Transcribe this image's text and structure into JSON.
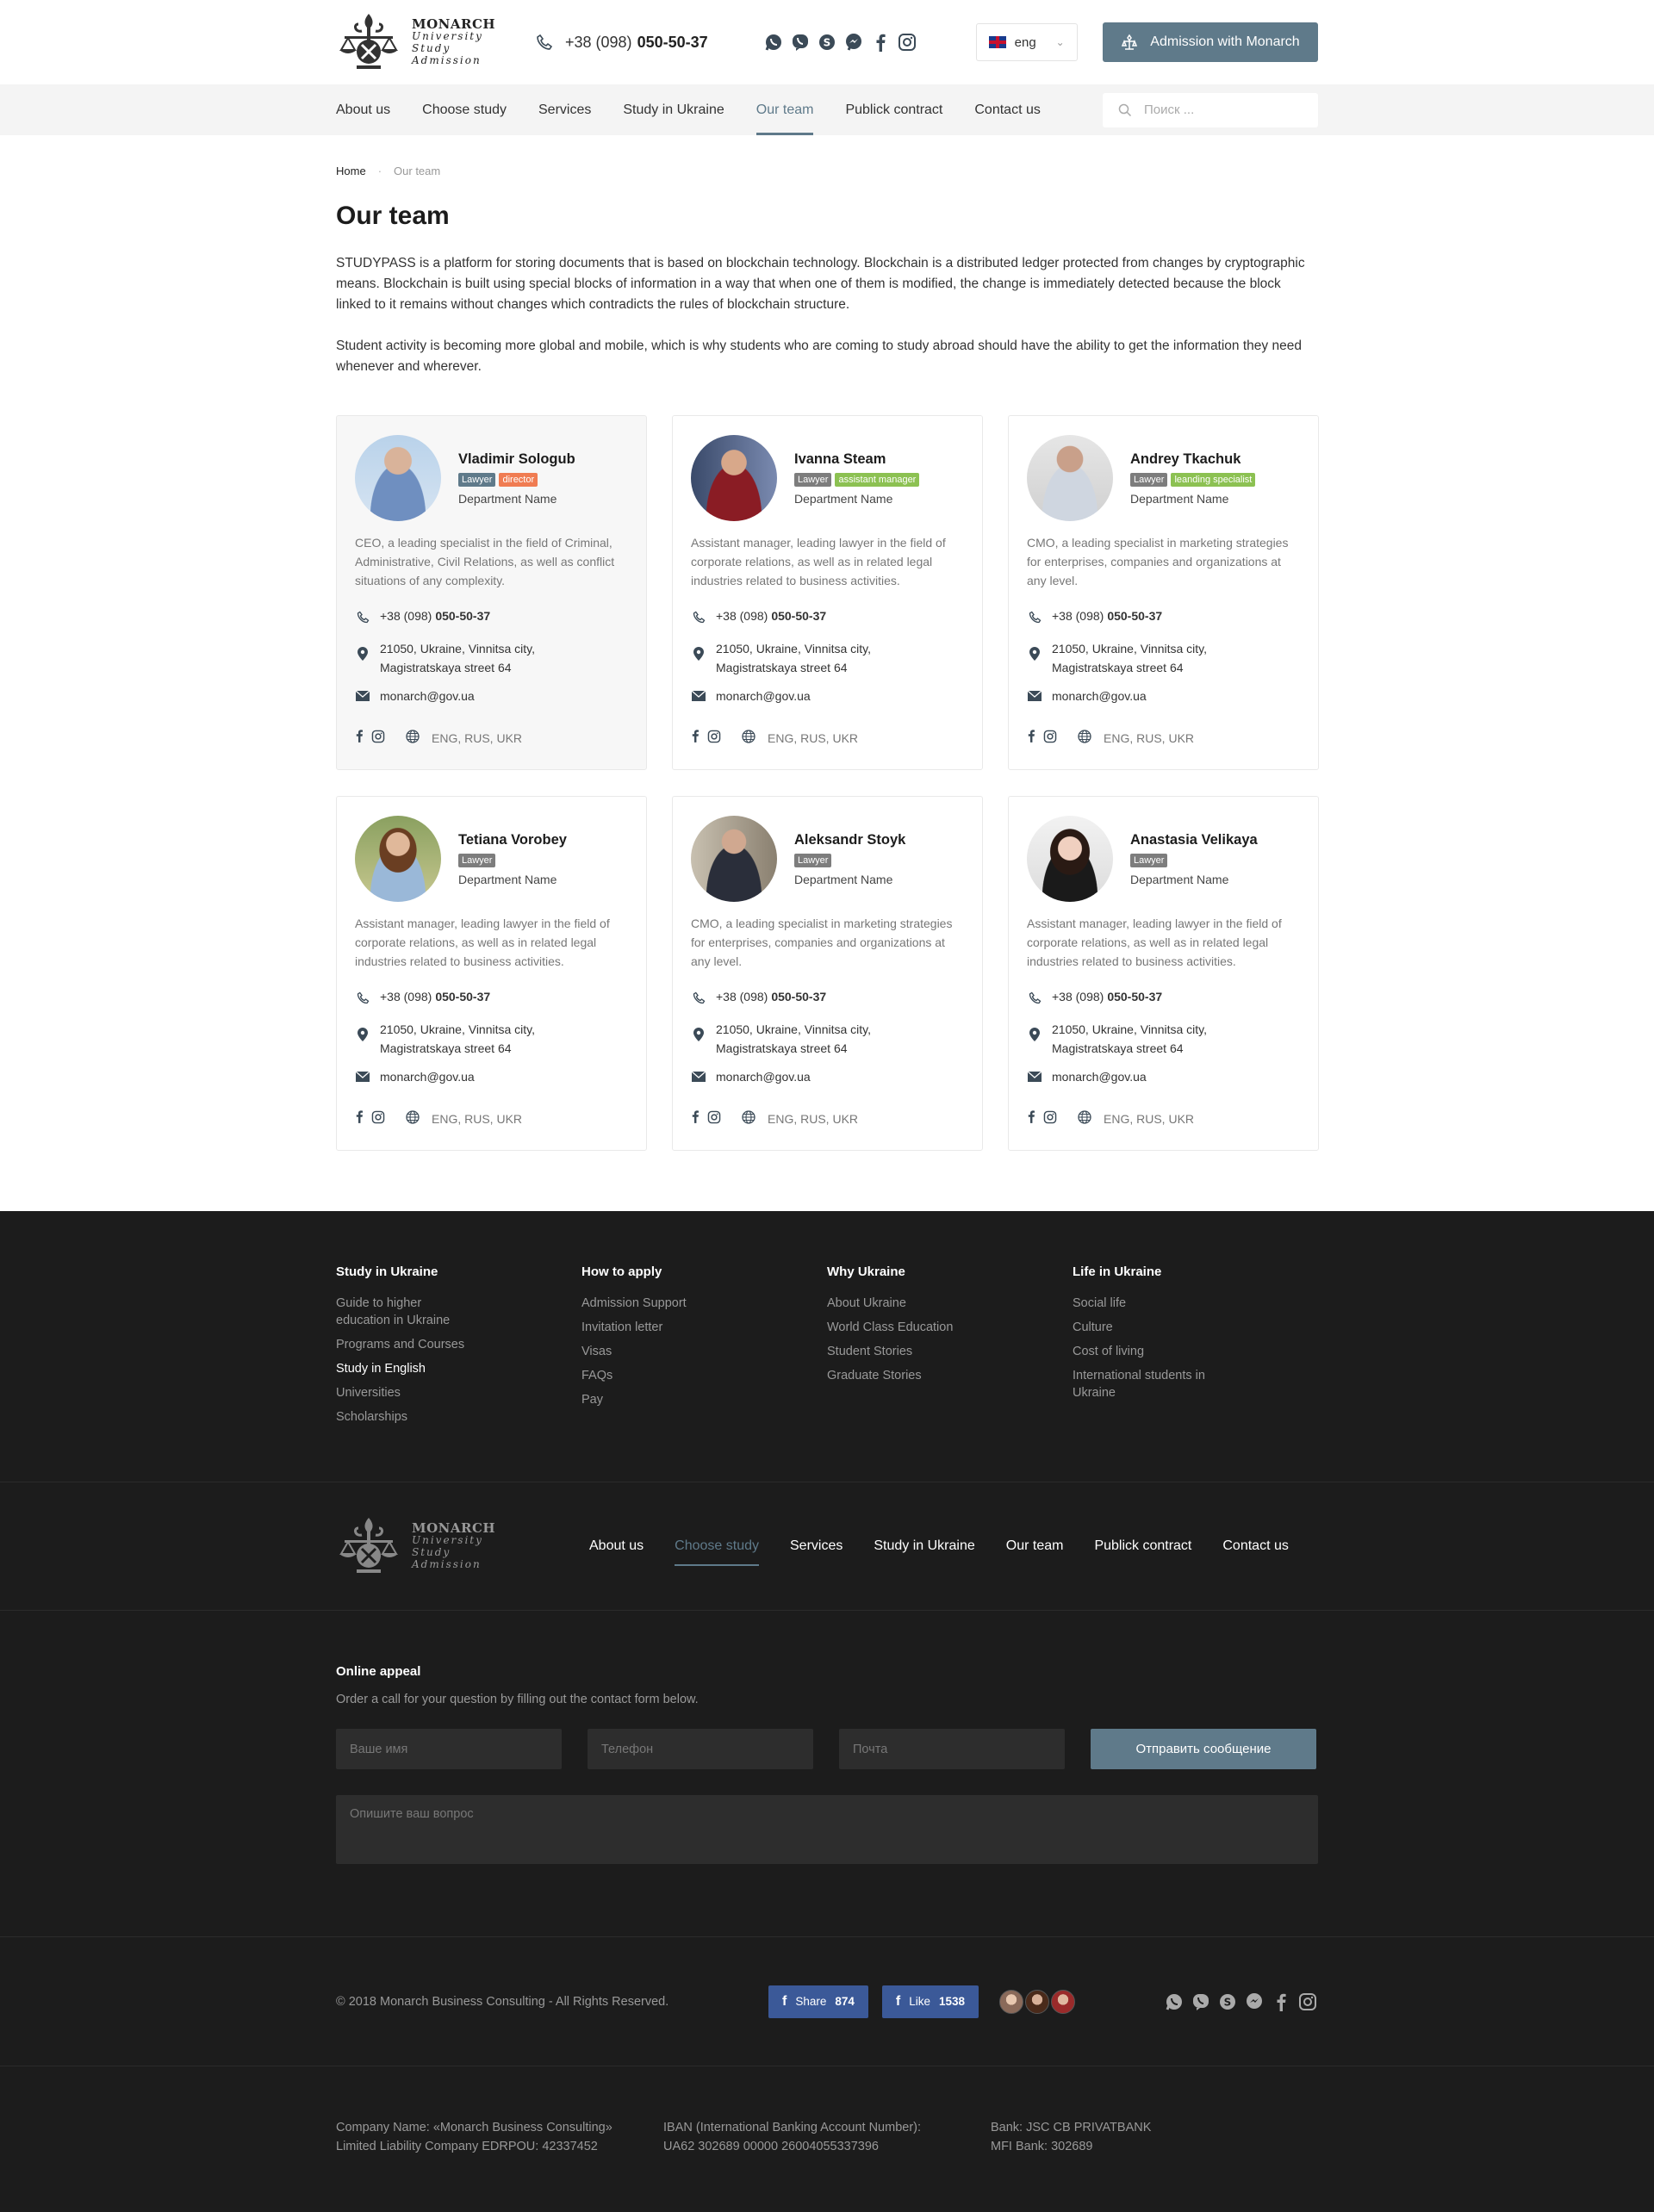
{
  "header": {
    "logo_lines": [
      "MONARCH",
      "University",
      "Study",
      "Admission"
    ],
    "phone_prefix": "+38 (098)",
    "phone_number": "050-50-37",
    "socials": [
      "whatsapp-icon",
      "viber-icon",
      "skype-icon",
      "messenger-icon",
      "facebook-icon",
      "instagram-icon"
    ],
    "lang": "eng",
    "admission_button": "Admission with Monarch"
  },
  "nav": {
    "items": [
      "About us",
      "Choose study",
      "Services",
      "Study in Ukraine",
      "Our team",
      "Publick contract",
      "Contact us"
    ],
    "active": "Our team",
    "search_placeholder": "Поиск ..."
  },
  "breadcrumb": {
    "home": "Home",
    "current": "Our team"
  },
  "page": {
    "title": "Our team",
    "intro1": "STUDYPASS is a platform for storing documents that is based on blockchain technology. Blockchain is a distributed ledger protected from changes by cryptographic means. Blockchain is built using special blocks of information in a way that when one of them is modified, the change is immediately detected because the block linked to it remains without changes which contradicts the rules of blockchain structure.",
    "intro2": "Student activity is becoming more global and mobile, which is why students who are coming to study abroad should have the ability to get the information they need whenever and wherever."
  },
  "team": [
    {
      "name": "Vladimir Sologub",
      "badges": [
        {
          "text": "Lawyer",
          "color": "#5f7a8a"
        },
        {
          "text": "director",
          "color": "#f07c52"
        }
      ],
      "dept": "Department Name",
      "desc": "CEO, a leading specialist in the field of Criminal, Administrative, Civil Relations, as well as conflict situations of any complexity.",
      "phone_prefix": "+38 (098)",
      "phone_number": "050-50-37",
      "address": "21050, Ukraine, Vinnitsa city, Magistratskaya street 64",
      "email": "monarch@gov.ua",
      "langs": "ENG, RUS, UKR"
    },
    {
      "name": "Ivanna Steam",
      "badges": [
        {
          "text": "Lawyer",
          "color": "#7d7d7d"
        },
        {
          "text": "assistant manager",
          "color": "#8cc152"
        }
      ],
      "dept": "Department Name",
      "desc": "Assistant manager, leading lawyer in the field of corporate relations, as well as in related legal industries related to business activities.",
      "phone_prefix": "+38 (098)",
      "phone_number": "050-50-37",
      "address": "21050, Ukraine, Vinnitsa city, Magistratskaya street 64",
      "email": "monarch@gov.ua",
      "langs": "ENG, RUS, UKR"
    },
    {
      "name": "Andrey Tkachuk",
      "badges": [
        {
          "text": "Lawyer",
          "color": "#7d7d7d"
        },
        {
          "text": "leanding specialist",
          "color": "#8cc152"
        }
      ],
      "dept": "Department Name",
      "desc": "CMO, a leading specialist in marketing strategies for enterprises, companies and organizations at any level.",
      "phone_prefix": "+38 (098)",
      "phone_number": "050-50-37",
      "address": "21050, Ukraine, Vinnitsa city, Magistratskaya street 64",
      "email": "monarch@gov.ua",
      "langs": "ENG, RUS, UKR"
    },
    {
      "name": "Tetiana Vorobey",
      "badges": [
        {
          "text": "Lawyer",
          "color": "#7d7d7d"
        }
      ],
      "dept": "Department Name",
      "desc": "Assistant manager, leading lawyer in the field of corporate relations, as well as in related legal industries related to business activities.",
      "phone_prefix": "+38 (098)",
      "phone_number": "050-50-37",
      "address": "21050, Ukraine, Vinnitsa city, Magistratskaya street 64",
      "email": "monarch@gov.ua",
      "langs": "ENG, RUS, UKR"
    },
    {
      "name": "Aleksandr Stoyk",
      "badges": [
        {
          "text": "Lawyer",
          "color": "#7d7d7d"
        }
      ],
      "dept": "Department Name",
      "desc": "CMO, a leading specialist in marketing strategies for enterprises, companies and organizations at any level.",
      "phone_prefix": "+38 (098)",
      "phone_number": "050-50-37",
      "address": "21050, Ukraine, Vinnitsa city, Magistratskaya street 64",
      "email": "monarch@gov.ua",
      "langs": "ENG, RUS, UKR"
    },
    {
      "name": "Anastasia Velikaya",
      "badges": [
        {
          "text": "Lawyer",
          "color": "#7d7d7d"
        }
      ],
      "dept": "Department Name",
      "desc": "Assistant manager, leading lawyer in the field of corporate relations, as well as in related legal industries related to business activities.",
      "phone_prefix": "+38 (098)",
      "phone_number": "050-50-37",
      "address": "21050, Ukraine, Vinnitsa city, Magistratskaya street 64",
      "email": "monarch@gov.ua",
      "langs": "ENG, RUS, UKR"
    }
  ],
  "footer": {
    "columns": [
      {
        "title": "Study in Ukraine",
        "links": [
          "Guide to higher education in Ukraine",
          "Programs and Courses",
          "Study in English",
          "Universities",
          "Scholarships"
        ],
        "highlight": "Study in English"
      },
      {
        "title": "How to apply",
        "links": [
          "Admission Support",
          "Invitation letter",
          "Visas",
          "FAQs",
          "Pay"
        ]
      },
      {
        "title": "Why Ukraine",
        "links": [
          "About Ukraine",
          "World Class Education",
          "Student Stories",
          "Graduate Stories"
        ]
      },
      {
        "title": "Life in Ukraine",
        "links": [
          "Social life",
          "Culture",
          "Cost of living",
          "International students in Ukraine"
        ]
      }
    ],
    "nav": [
      "About us",
      "Choose study",
      "Services",
      "Study in Ukraine",
      "Our team",
      "Publick contract",
      "Contact us"
    ],
    "nav_active": "Choose study",
    "appeal": {
      "title": "Online appeal",
      "subtitle": "Order a call for your question by filling out the contact form below.",
      "name_placeholder": "Ваше имя",
      "phone_placeholder": "Телефон",
      "email_placeholder": "Почта",
      "send_button": "Отправить сообщение",
      "message_placeholder": "Опишите ваш вопрос"
    },
    "copyright": "© 2018 Monarch Business Consulting - All Rights Reserved.",
    "share": {
      "label": "Share",
      "count": "874"
    },
    "like": {
      "label": "Like",
      "count": "1538"
    },
    "bank": {
      "company_line1": "Company Name: «Monarch Business Consulting»",
      "company_line2": "Limited Liability Company EDRPOU: 42337452",
      "iban_line1": "IBAN (International Banking Account Number):",
      "iban_line2": "UA62 302689 00000 26004055337396",
      "bank_line1": "Bank: JSC CB PRIVATBANK",
      "bank_line2": "MFI Bank: 302689"
    }
  },
  "colors": {
    "accent": "#5f7a8a",
    "footer_bg": "#1c1c1c",
    "facebook": "#3b5998"
  }
}
